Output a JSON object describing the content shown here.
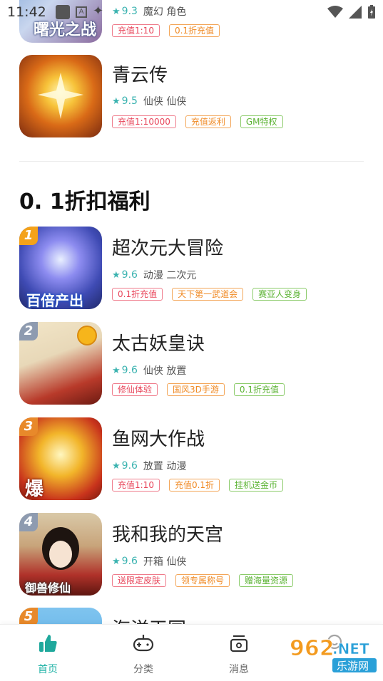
{
  "status_bar": {
    "time": "11:42"
  },
  "apps_top": [
    {
      "name": "",
      "rating": "9.3",
      "genres": "魔幻 角色",
      "icon_text": "曙光之战",
      "tags": [
        {
          "text": "充值1:10",
          "color": "red"
        },
        {
          "text": "0.1折充值",
          "color": "orange"
        }
      ]
    },
    {
      "name": "青云传",
      "rating": "9.5",
      "genres": "仙侠 仙侠",
      "tags": [
        {
          "text": "充值1:10000",
          "color": "red"
        },
        {
          "text": "充值返利",
          "color": "orange"
        },
        {
          "text": "GM特权",
          "color": "green"
        }
      ]
    }
  ],
  "section": {
    "title": "0. 1折扣福利"
  },
  "apps": [
    {
      "rank": "1",
      "name": "超次元大冒险",
      "rating": "9.6",
      "genres": "动漫 二次元",
      "icon_text": "百倍产出",
      "tags": [
        {
          "text": "0.1折充值",
          "color": "red"
        },
        {
          "text": "天下第一武道会",
          "color": "orange"
        },
        {
          "text": "赛亚人变身",
          "color": "green"
        }
      ]
    },
    {
      "rank": "2",
      "name": "太古妖皇诀",
      "rating": "9.6",
      "genres": "仙侠 放置",
      "tags": [
        {
          "text": "修仙体验",
          "color": "red"
        },
        {
          "text": "国风3D手游",
          "color": "orange"
        },
        {
          "text": "0.1折充值",
          "color": "green"
        }
      ]
    },
    {
      "rank": "3",
      "name": "鱼网大作战",
      "rating": "9.6",
      "genres": "放置 动漫",
      "icon_text": "爆",
      "tags": [
        {
          "text": "充值1:10",
          "color": "red"
        },
        {
          "text": "充值0.1折",
          "color": "orange"
        },
        {
          "text": "挂机送金币",
          "color": "green"
        }
      ]
    },
    {
      "rank": "4",
      "name": "我和我的天宫",
      "rating": "9.6",
      "genres": "开箱 仙侠",
      "icon_text": "御兽修仙",
      "tags": [
        {
          "text": "送限定皮肤",
          "color": "red"
        },
        {
          "text": "领专属称号",
          "color": "orange"
        },
        {
          "text": "赠海量资源",
          "color": "green"
        }
      ]
    },
    {
      "rank": "5",
      "name": "海洋王国",
      "rating": "",
      "genres": "",
      "tags": []
    }
  ],
  "bottom_nav": [
    {
      "label": "首页",
      "icon": "thumbs-up-icon",
      "active": true
    },
    {
      "label": "分类",
      "icon": "gamepad-icon",
      "active": false
    },
    {
      "label": "消息",
      "icon": "message-box-icon",
      "active": false
    },
    {
      "label": "",
      "icon": "smiley-icon",
      "active": false
    }
  ],
  "watermark": {
    "text": "962.NET",
    "subtext": "乐游网"
  },
  "colors": {
    "accent": "#22b3a7",
    "star": "#3bb3b0"
  }
}
